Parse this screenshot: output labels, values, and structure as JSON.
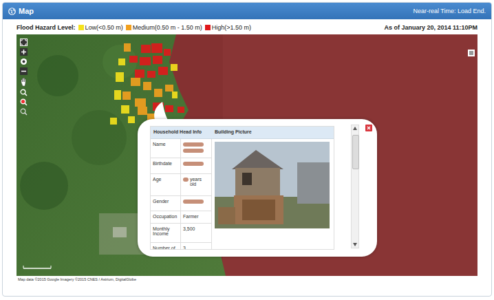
{
  "panel": {
    "title": "Map",
    "status": "Near-real Time: Load End."
  },
  "legend": {
    "label": "Flood Hazard Level:",
    "items": [
      {
        "label": "Low(<0.50 m)",
        "kind": "low",
        "color": "#f5e21c"
      },
      {
        "label": "Medium(0.50 m - 1.50 m)",
        "kind": "medium",
        "color": "#f2a01e"
      },
      {
        "label": "High(>1.50 m)",
        "kind": "high",
        "color": "#e0181b"
      }
    ],
    "timestamp": "As of January 20, 2014 11:10PM"
  },
  "map": {
    "attribution": "Map data ©2015 Google Imagery ©2015 CNES / Astrium, DigitalGlobe",
    "hazard_areas": [
      {
        "kind": "high"
      },
      {
        "kind": "high"
      },
      {
        "kind": "high"
      },
      {
        "kind": "high"
      },
      {
        "kind": "high"
      },
      {
        "kind": "high"
      },
      {
        "kind": "high"
      },
      {
        "kind": "high"
      },
      {
        "kind": "high"
      },
      {
        "kind": "high"
      },
      {
        "kind": "high"
      },
      {
        "kind": "high"
      },
      {
        "kind": "medium"
      },
      {
        "kind": "medium"
      },
      {
        "kind": "medium"
      },
      {
        "kind": "medium"
      },
      {
        "kind": "medium"
      },
      {
        "kind": "medium"
      },
      {
        "kind": "medium"
      },
      {
        "kind": "medium"
      },
      {
        "kind": "medium"
      },
      {
        "kind": "low"
      },
      {
        "kind": "low"
      },
      {
        "kind": "low"
      },
      {
        "kind": "low"
      },
      {
        "kind": "low"
      },
      {
        "kind": "low"
      },
      {
        "kind": "low"
      },
      {
        "kind": "low"
      }
    ]
  },
  "popup": {
    "columns": [
      "Household Head Info",
      "Building Picture"
    ],
    "rows": [
      {
        "label": "Name",
        "value": "",
        "redacted": true,
        "redacted_lines": 2
      },
      {
        "label": "Birthdate",
        "value": "",
        "redacted": true,
        "redacted_lines": 1
      },
      {
        "label": "Age",
        "value": "years old",
        "redacted": true,
        "redacted_lines": 1
      },
      {
        "label": "Gender",
        "value": "",
        "redacted": true,
        "redacted_lines": 1
      },
      {
        "label": "Occupation",
        "value": "Farmer",
        "redacted": false,
        "redacted_lines": 0
      },
      {
        "label": "Monthly Income",
        "value": "3,500",
        "redacted": false,
        "redacted_lines": 0
      },
      {
        "label": "Number of",
        "value": "3",
        "redacted": false,
        "redacted_lines": 0
      }
    ]
  }
}
